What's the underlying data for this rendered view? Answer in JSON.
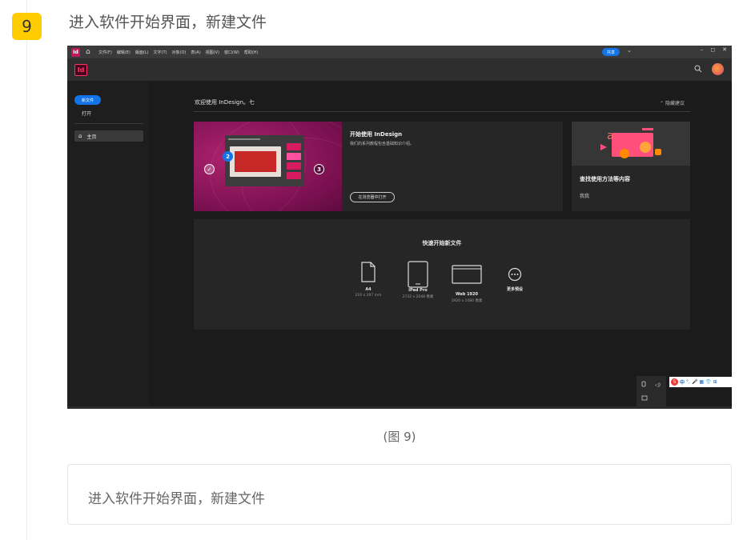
{
  "step": {
    "number": "9",
    "title": "进入软件开始界面，新建文件"
  },
  "screenshot": {
    "menubar": {
      "app_icon": "Id",
      "items": [
        "文件(F)",
        "编辑(E)",
        "版面(L)",
        "文字(T)",
        "对象(O)",
        "表(A)",
        "视图(V)",
        "窗口(W)",
        "帮助(H)"
      ],
      "share_label": "共享",
      "window_controls": [
        "–",
        "◻",
        "✕"
      ]
    },
    "appbar": {
      "logo": "Id"
    },
    "sidebar": {
      "new_file_label": "新文件",
      "open_label": "打开",
      "home_label": "主页"
    },
    "welcome": {
      "title": "欢迎使用 InDesign。七",
      "hide_suggestions": "隐藏建议"
    },
    "card_getting_started": {
      "title": "开始使用 InDesign",
      "subtitle": "我们的系列教程包含基础知识介绍。",
      "button_label": "在浏览器中打开",
      "step_labels": [
        "2",
        "3"
      ]
    },
    "card_find": {
      "title": "查找使用方法等内容",
      "subtitle": "我我"
    },
    "quick_start": {
      "title": "快速开始新文件",
      "presets": [
        {
          "name": "A4",
          "size": "210 x 297 mm"
        },
        {
          "name": "iPad Pro",
          "size": "2732 x 2048 像素"
        },
        {
          "name": "Web 1920",
          "size": "1920 x 1080 像素"
        },
        {
          "name": "更多预设",
          "size": ""
        }
      ]
    },
    "ime_bar": {
      "logo": "S",
      "items": [
        "中",
        "°,",
        "🎤",
        "▦",
        "👕",
        "⊞"
      ]
    },
    "colors": {
      "accent": "#1473e6",
      "id_pink": "#ff3366",
      "badge_yellow": "#ffcc00"
    }
  },
  "caption": "(图 9)",
  "note": "进入软件开始界面，新建文件"
}
